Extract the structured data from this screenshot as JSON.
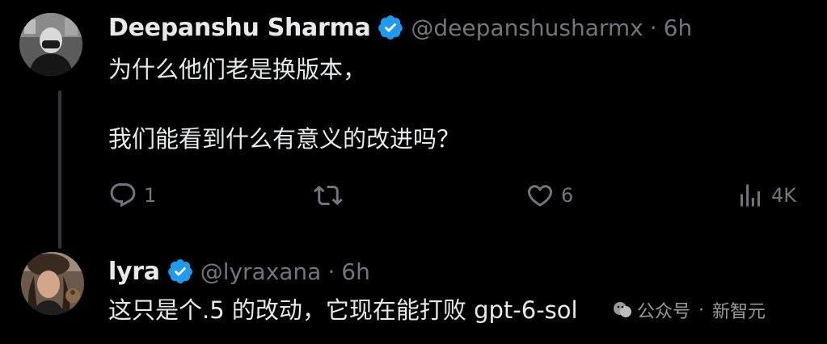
{
  "tweets": [
    {
      "display_name": "Deepanshu Sharma",
      "handle": "@deepanshusharmx",
      "separator": "·",
      "time": "6h",
      "lines": [
        "为什么他们老是换版本，",
        "我们能看到什么有意义的改进吗？"
      ],
      "actions": {
        "reply_count": "1",
        "retweet_count": "",
        "like_count": "6",
        "view_count": "4K"
      }
    },
    {
      "display_name": "lyra",
      "handle": "@lyraxana",
      "separator": "·",
      "time": "6h",
      "lines": [
        "这只是个.5 的改动，它现在能打败 gpt-6-sol"
      ]
    }
  ],
  "watermark": {
    "left": "公众号",
    "separator": "·",
    "right": "新智元"
  },
  "colors": {
    "background": "#000000",
    "text": "#e7e9ea",
    "secondary": "#71767b",
    "verified": "#1d9bf0",
    "thread_line": "#333639"
  },
  "icons": [
    "reply-icon",
    "retweet-icon",
    "like-icon",
    "views-icon",
    "verified-badge-icon"
  ]
}
